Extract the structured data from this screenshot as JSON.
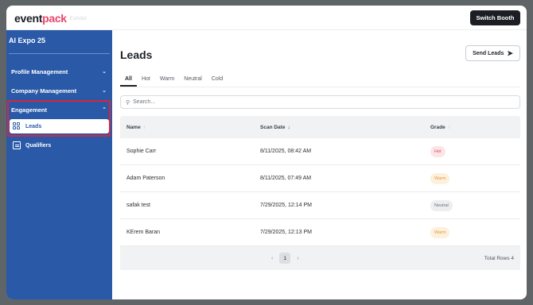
{
  "header": {
    "logo_part1": "event",
    "logo_part2": "pack",
    "logo_sub": "Exhibit",
    "switch_booth_label": "Switch Booth"
  },
  "sidebar": {
    "event_title": "AI Expo 25",
    "sections": [
      {
        "label": "Profile Management",
        "chevron": "⌄"
      },
      {
        "label": "Company Management",
        "chevron": "⌄"
      },
      {
        "label": "Engagement",
        "chevron": "⌃"
      }
    ],
    "sub_items": [
      {
        "label": "Leads",
        "icon": "grid-icon",
        "active": true
      },
      {
        "label": "Qualifiers",
        "icon": "document-icon",
        "active": false
      }
    ]
  },
  "main": {
    "title": "Leads",
    "send_leads_label": "Send Leads",
    "tabs": [
      "All",
      "Hot",
      "Warm",
      "Neutral",
      "Cold"
    ],
    "active_tab": "All",
    "search_placeholder": "Search...",
    "columns": {
      "name": "Name",
      "scan_date": "Scan Date",
      "grade": "Grade"
    },
    "rows": [
      {
        "name": "Sophie Carr",
        "scan_date": "8/11/2025, 08:42 AM",
        "grade": "Hot"
      },
      {
        "name": "Adam Paterson",
        "scan_date": "8/11/2025, 07:49 AM",
        "grade": "Warm"
      },
      {
        "name": "safak test",
        "scan_date": "7/29/2025, 12:14 PM",
        "grade": "Neutral"
      },
      {
        "name": "KErem Baran",
        "scan_date": "7/29/2025, 12:13 PM",
        "grade": "Warm"
      }
    ],
    "pagination": {
      "prev": "‹",
      "current_page": "1",
      "next": "›",
      "total_rows": "Total Rows 4"
    }
  },
  "colors": {
    "sidebar_bg": "#2a59a8",
    "brand_pink": "#e8466b",
    "highlight_red": "#d7263d",
    "hot": "#d84a57",
    "warm": "#e69a33",
    "neutral": "#6b7078"
  }
}
